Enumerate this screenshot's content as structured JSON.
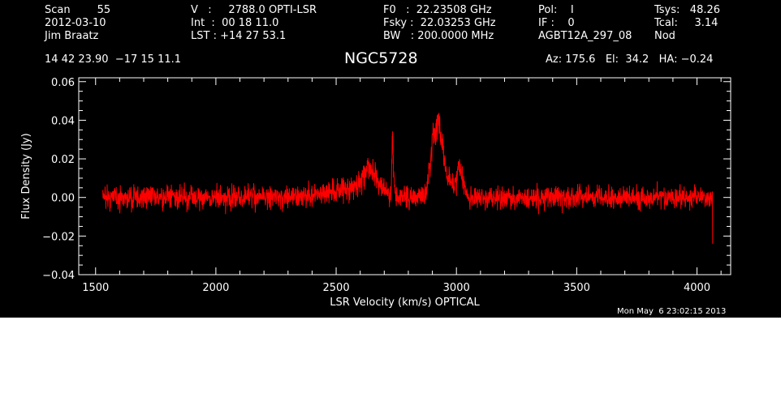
{
  "header": {
    "col1": {
      "r1": "Scan        55",
      "r2": "2012-03-10",
      "r3": "Jim Braatz"
    },
    "col2": {
      "r1": "V   :     2788.0 OPTI-LSR",
      "r2": "Int  :  00 18 11.0",
      "r3": "LST : +14 27 53.1"
    },
    "col3": {
      "r1": "F0   :  22.23508 GHz",
      "r2": "Fsky :  22.03253 GHz",
      "r3": "BW   : 200.0000 MHz"
    },
    "col4": {
      "r1": "Pol:    I",
      "r2": "IF :    0",
      "r3": "AGBT12A_297_08"
    },
    "col5": {
      "r1": "Tsys:   48.26",
      "r2": "Tcal:     3.14",
      "r3": "Nod"
    },
    "coords": "14 42 23.90  −17 15 11.1",
    "az_el_ha": "Az: 175.6   El:  34.2   HA: −0.24"
  },
  "timestamp": "Mon May  6 23:02:15 2013",
  "chart_data": {
    "type": "line",
    "title": "NGC5728",
    "xlabel": "LSR Velocity (km/s) OPTICAL",
    "ylabel": "Flux Density (Jy)",
    "xlim": [
      1430,
      4140
    ],
    "ylim": [
      -0.04,
      0.062
    ],
    "x_ticks": [
      1500,
      2000,
      2500,
      3000,
      3500,
      4000
    ],
    "y_ticks": [
      -0.04,
      -0.02,
      0.0,
      0.02,
      0.04,
      0.06
    ],
    "y_tick_labels": [
      "−0.04",
      "−0.02",
      "0.00",
      "0.02",
      "0.04",
      "0.06"
    ],
    "series_color": "#ff0000",
    "axis_color": "#ffffff",
    "background": "#000000",
    "series": [
      {
        "x_range": [
          1530,
          4065
        ],
        "noise_rms": 0.0055,
        "features": [
          {
            "velocity": 2560,
            "width": 120,
            "peak": 0.004
          },
          {
            "velocity": 2640,
            "width": 30,
            "peak": 0.012
          },
          {
            "velocity": 2735,
            "width": 3,
            "peak": 0.032
          },
          {
            "velocity": 2905,
            "width": 15,
            "peak": 0.028
          },
          {
            "velocity": 2930,
            "width": 12,
            "peak": 0.022
          },
          {
            "velocity": 2950,
            "width": 25,
            "peak": 0.013
          },
          {
            "velocity": 3015,
            "width": 12,
            "peak": 0.016
          }
        ]
      }
    ]
  }
}
